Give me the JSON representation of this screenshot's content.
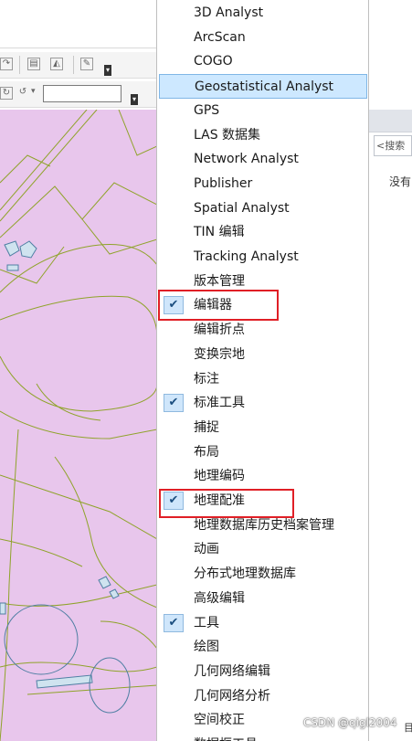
{
  "menu": {
    "items": [
      {
        "label": "3D Analyst",
        "checked": false
      },
      {
        "label": "ArcScan",
        "checked": false
      },
      {
        "label": "COGO",
        "checked": false
      },
      {
        "label": "Geostatistical Analyst",
        "checked": false,
        "selected": true
      },
      {
        "label": "GPS",
        "checked": false
      },
      {
        "label": "LAS 数据集",
        "checked": false
      },
      {
        "label": "Network Analyst",
        "checked": false
      },
      {
        "label": "Publisher",
        "checked": false
      },
      {
        "label": "Spatial Analyst",
        "checked": false
      },
      {
        "label": "TIN 编辑",
        "checked": false
      },
      {
        "label": "Tracking Analyst",
        "checked": false
      },
      {
        "label": "版本管理",
        "checked": false
      },
      {
        "label": "编辑器",
        "checked": true,
        "highlighted": true
      },
      {
        "label": "编辑折点",
        "checked": false
      },
      {
        "label": "变换宗地",
        "checked": false
      },
      {
        "label": "标注",
        "checked": false
      },
      {
        "label": "标准工具",
        "checked": true
      },
      {
        "label": "捕捉",
        "checked": false
      },
      {
        "label": "布局",
        "checked": false
      },
      {
        "label": "地理编码",
        "checked": false
      },
      {
        "label": "地理配准",
        "checked": true,
        "highlighted": true
      },
      {
        "label": "地理数据库历史档案管理",
        "checked": false
      },
      {
        "label": "动画",
        "checked": false
      },
      {
        "label": "分布式地理数据库",
        "checked": false
      },
      {
        "label": "高级编辑",
        "checked": false
      },
      {
        "label": "工具",
        "checked": true
      },
      {
        "label": "绘图",
        "checked": false
      },
      {
        "label": "几何网络编辑",
        "checked": false
      },
      {
        "label": "几何网络分析",
        "checked": false
      },
      {
        "label": "空间校正",
        "checked": false
      },
      {
        "label": "数据框工具",
        "checked": false
      }
    ],
    "check_glyph": "✔",
    "selected_color": "#cde8ff",
    "highlight_color": "#e01f26"
  },
  "right_panel": {
    "search_placeholder": "<搜索",
    "message": "没有",
    "bottom_text": "目"
  },
  "map": {
    "fill_color": "#e8c6ec",
    "line_color": "#8fa32a"
  },
  "watermark": "CSDN @qigl2004"
}
